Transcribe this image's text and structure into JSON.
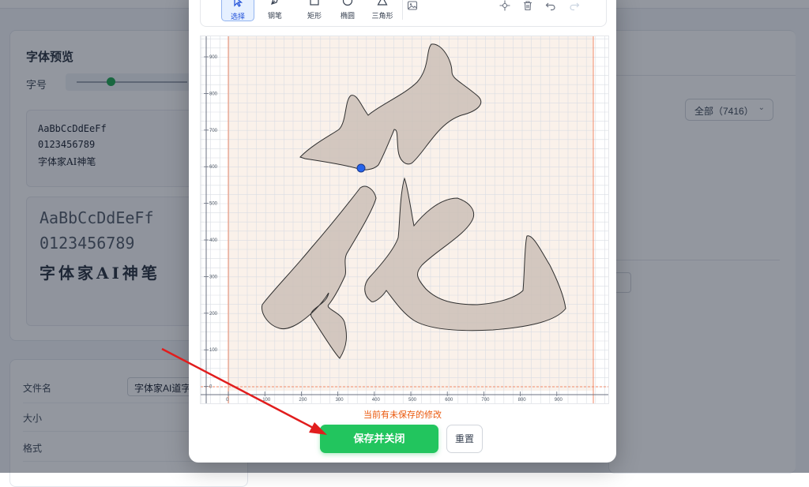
{
  "preview": {
    "title": "字体预览",
    "size_label": "字号",
    "sample_small": [
      "AaBbCcDdEeFf",
      "0123456789",
      "字体家AI神笔"
    ],
    "sample_large": [
      "AaBbCcDdEeFf",
      "0123456789",
      "字体家AI神笔"
    ]
  },
  "right_panel": {
    "filter_select": "全部（7416）"
  },
  "file_info": {
    "filename_label": "文件名",
    "filename_value": "字体家AI道字和",
    "size_label": "大小",
    "format_label": "格式"
  },
  "toolbar": {
    "tools": [
      {
        "label": "选择",
        "icon": "pointer-icon"
      },
      {
        "label": "钢笔",
        "icon": "pen-icon"
      },
      {
        "label": "矩形",
        "icon": "rectangle-icon"
      },
      {
        "label": "椭圆",
        "icon": "ellipse-icon"
      },
      {
        "label": "三角形",
        "icon": "triangle-icon"
      }
    ],
    "active_tool": "选择"
  },
  "canvas": {
    "y_ticks": [
      "900",
      "800",
      "700",
      "600",
      "500",
      "400",
      "300",
      "200",
      "100",
      "0"
    ],
    "x_ticks": [
      "0",
      "100",
      "200",
      "300",
      "400",
      "500",
      "600",
      "700",
      "800",
      "900"
    ]
  },
  "footer": {
    "unsaved_notice": "当前有未保存的修改",
    "save_button": "保存并关闭",
    "reset_button": "重置"
  },
  "colors": {
    "accent_green": "#22c55e",
    "warning_orange": "#ea580c",
    "guide_line": "#f08a6a",
    "glyph_fill": "#cbbfb7"
  }
}
